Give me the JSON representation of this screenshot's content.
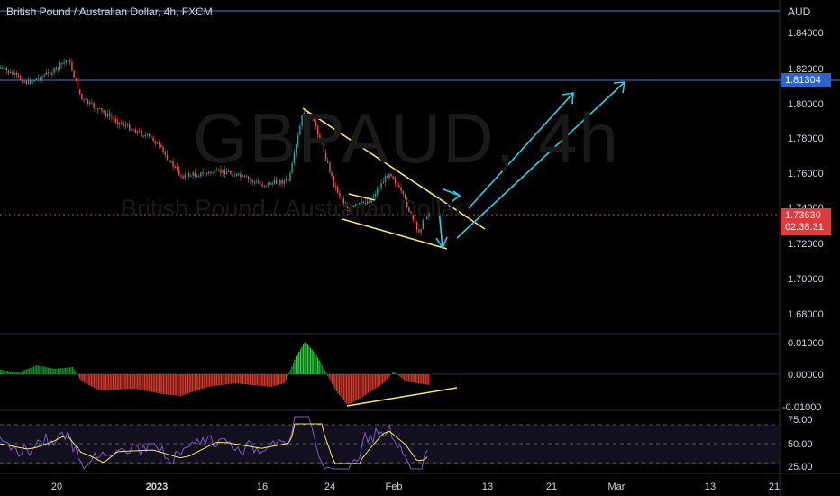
{
  "header": {
    "symbol_title": "British Pound / Australian Dollar, 4h, FXCM",
    "currency": "AUD"
  },
  "watermark": {
    "ticker": "GBPAUD, 4h",
    "name": "British Pound / Australian Dollar"
  },
  "price_axis": {
    "ticks": [
      "1.84000",
      "1.82000",
      "1.80000",
      "1.78000",
      "1.76000",
      "1.74000",
      "1.72000",
      "1.70000",
      "1.68000"
    ],
    "target_price": "1.81304",
    "current_price": "1.73630",
    "countdown": "02:38:31"
  },
  "oscillator_axis": {
    "ticks": [
      "0.01000",
      "0.00000",
      "-0.01000"
    ]
  },
  "rsi_axis": {
    "ticks": [
      "75.00",
      "50.00",
      "25.00"
    ]
  },
  "time_axis": {
    "labels": [
      "20",
      "2023",
      "16",
      "24",
      "Feb",
      "13",
      "21",
      "Mar",
      "13",
      "21"
    ]
  },
  "colors": {
    "background": "#000000",
    "bull": "#26a69a",
    "bear": "#ef5350",
    "drawing_yellow": "#f5e663",
    "drawing_cyan": "#22d3ee",
    "level_line": "#4a7bd8"
  }
}
